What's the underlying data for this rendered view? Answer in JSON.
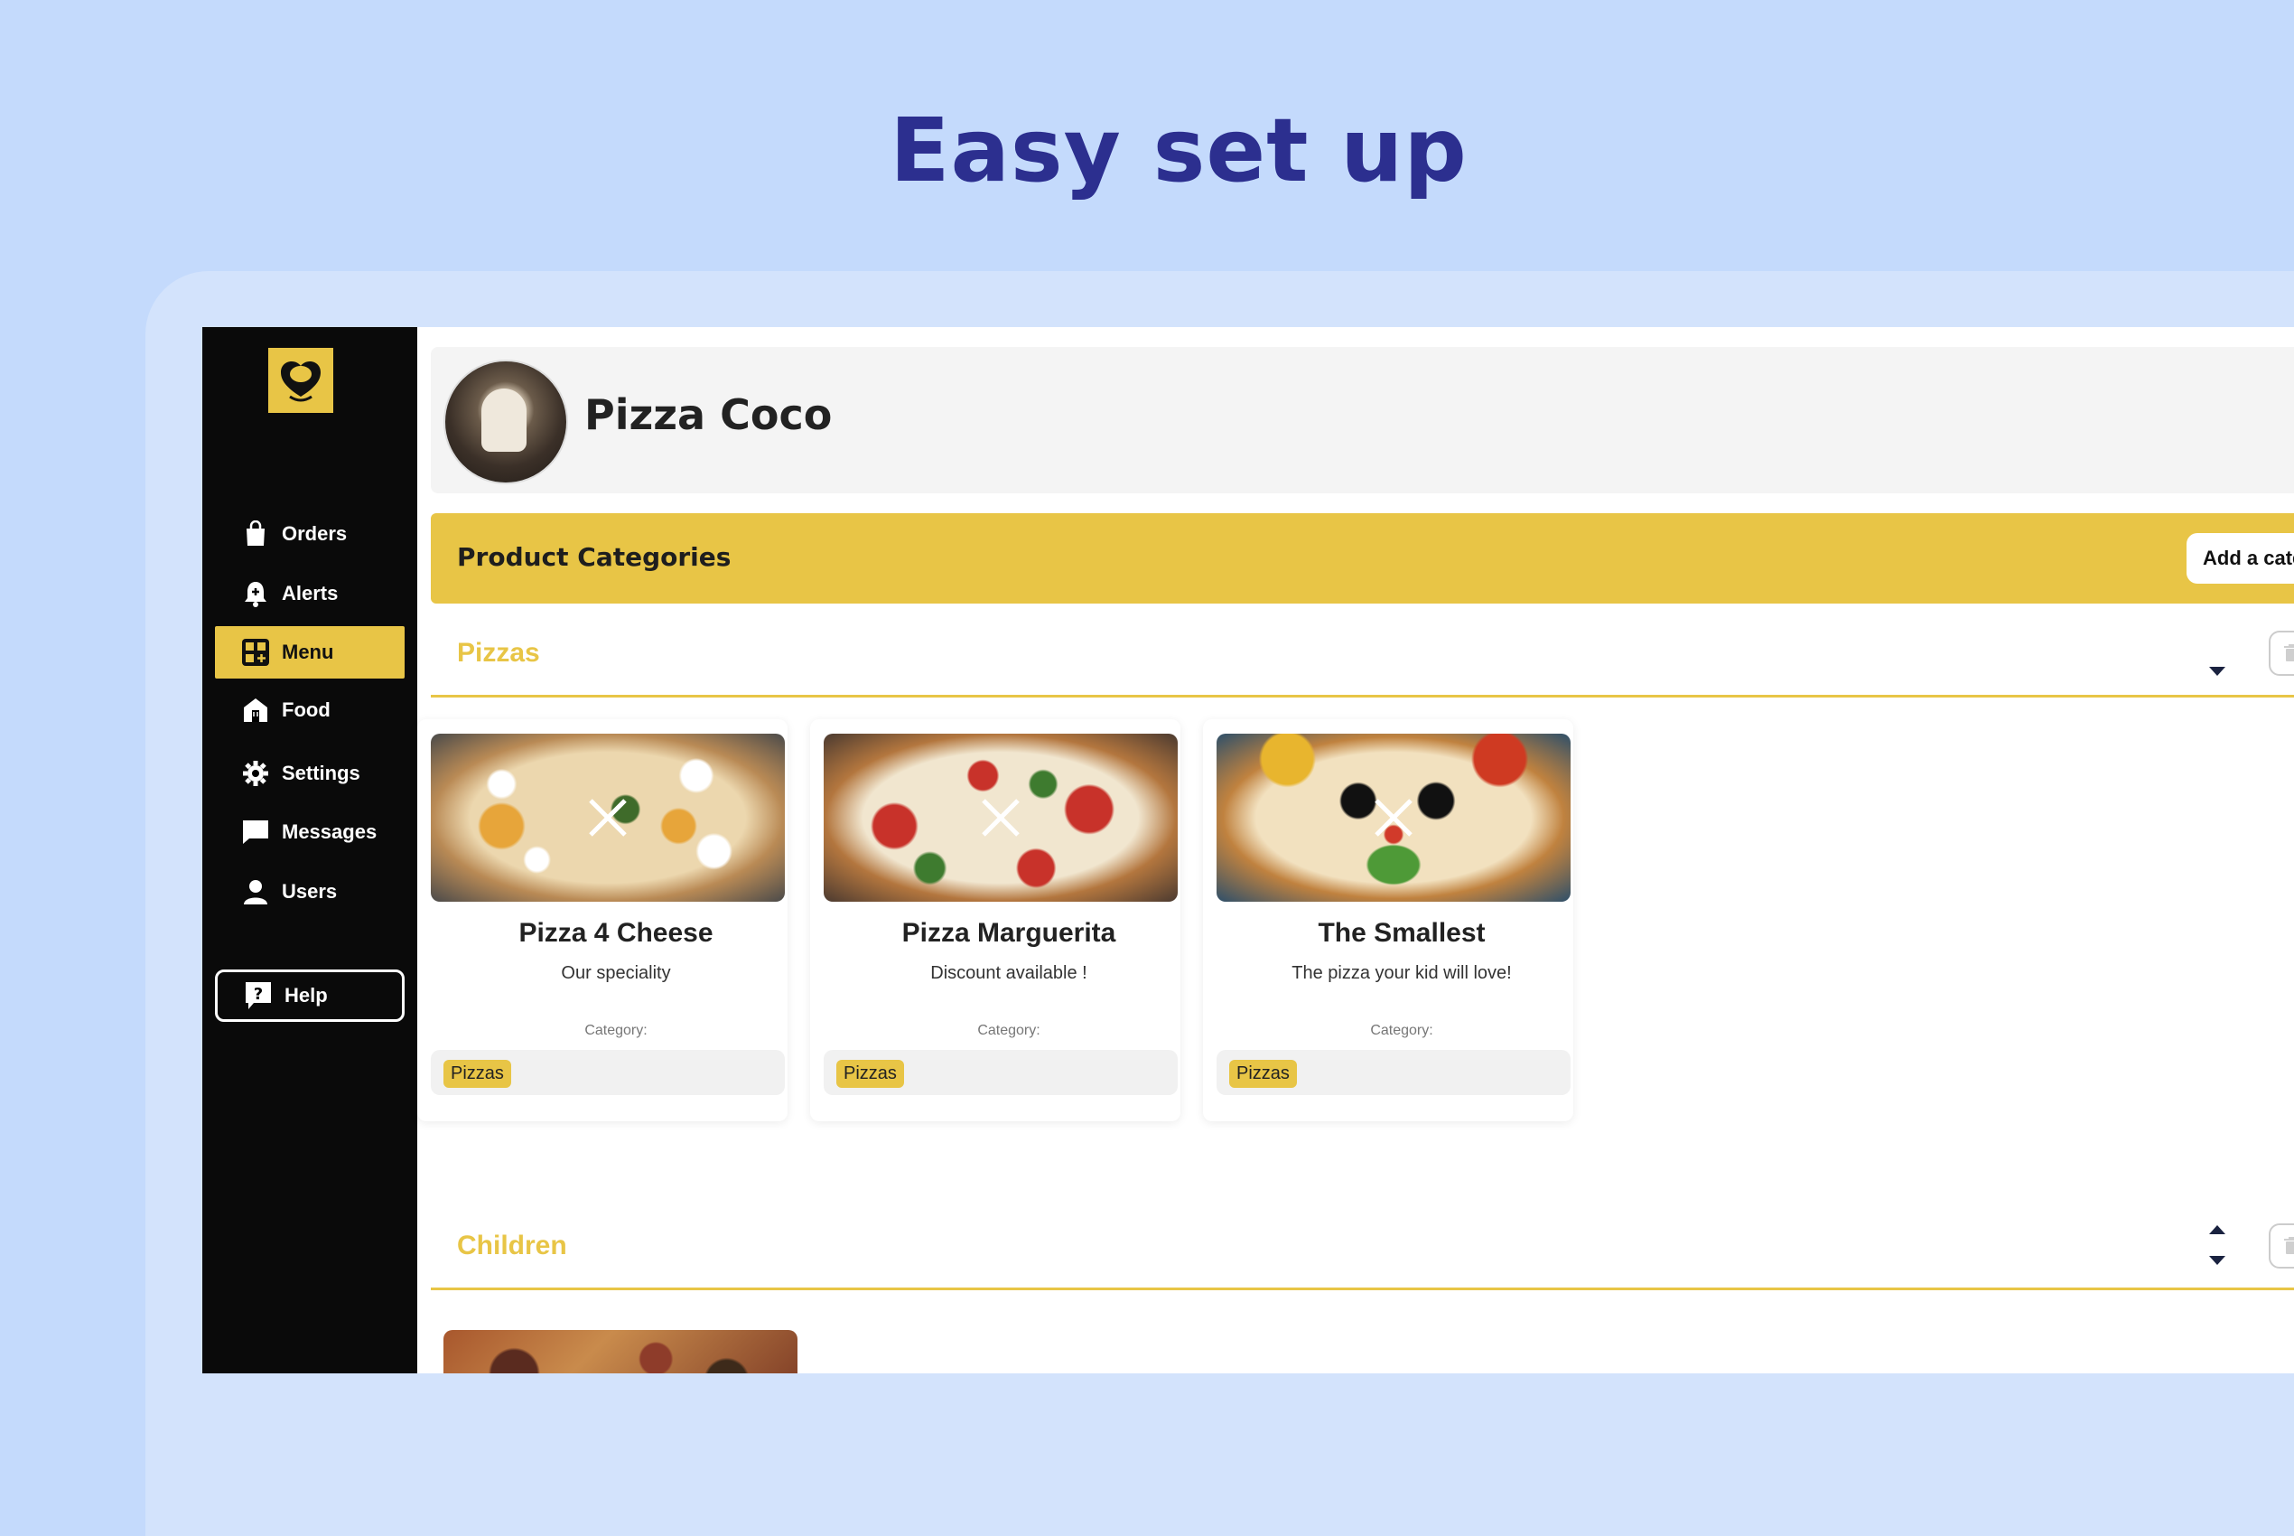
{
  "headline": "Easy set up",
  "sidebar": {
    "items": [
      {
        "label": "Orders",
        "icon": "bag-icon"
      },
      {
        "label": "Alerts",
        "icon": "bell-icon"
      },
      {
        "label": "Menu",
        "icon": "menu-grid-icon",
        "active": true
      },
      {
        "label": "Food",
        "icon": "food-store-icon"
      },
      {
        "label": "Settings",
        "icon": "gear-icon"
      },
      {
        "label": "Messages",
        "icon": "chat-icon"
      },
      {
        "label": "Users",
        "icon": "user-icon"
      }
    ],
    "help_label": "Help"
  },
  "restaurant": {
    "name": "Pizza Coco"
  },
  "categories_bar": {
    "title": "Product Categories",
    "add_button": "Add a category"
  },
  "sections": [
    {
      "title": "Pizzas",
      "products": [
        {
          "name": "Pizza 4 Cheese",
          "description": "Our speciality",
          "category_label": "Category:",
          "category": "Pizzas"
        },
        {
          "name": "Pizza Marguerita",
          "description": "Discount available !",
          "category_label": "Category:",
          "category": "Pizzas"
        },
        {
          "name": "The Smallest",
          "description": "The pizza your kid will love!",
          "category_label": "Category:",
          "category": "Pizzas"
        }
      ]
    },
    {
      "title": "Children"
    }
  ],
  "colors": {
    "background": "#c4dafc",
    "headline": "#2c2f8f",
    "accent_yellow": "#e8c546",
    "sidebar": "#0a0a0a"
  }
}
